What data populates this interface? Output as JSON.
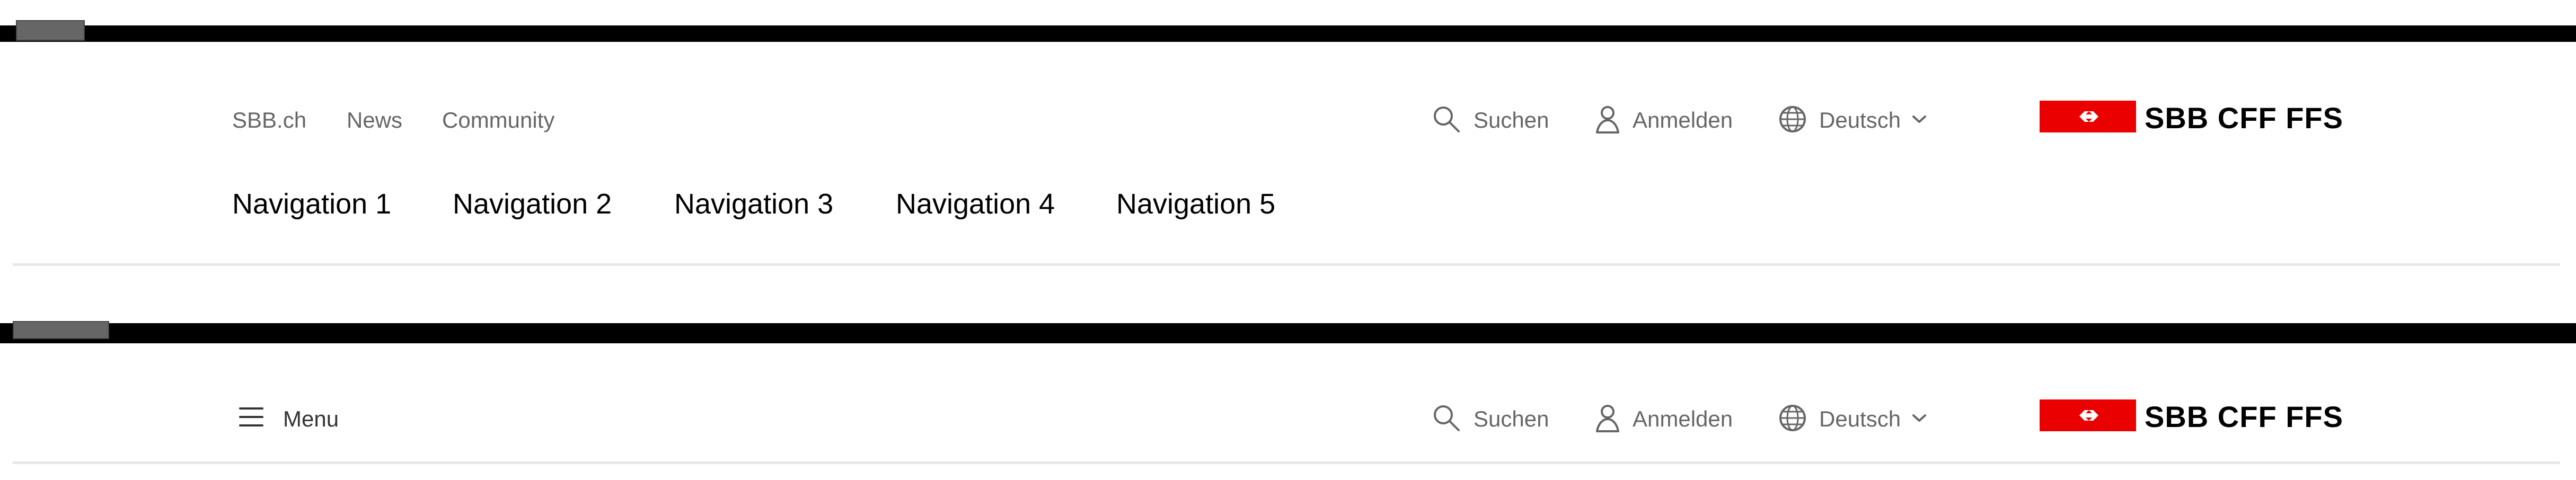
{
  "header": {
    "meta_links": [
      "SBB.ch",
      "News",
      "Community"
    ],
    "search_label": "Suchen",
    "login_label": "Anmelden",
    "language_label": "Deutsch",
    "brand_name": "SBB CFF FFS",
    "menu_label": "Menu"
  },
  "navigation": {
    "items": [
      "Navigation 1",
      "Navigation 2",
      "Navigation 3",
      "Navigation 4",
      "Navigation 5"
    ]
  },
  "icons": {
    "search": "search-icon",
    "login": "user-icon",
    "language": "globe-icon",
    "dropdown": "chevron-down-icon",
    "menu": "menu-icon",
    "logo": "sbb-logo-icon"
  },
  "colors": {
    "brand_red": "#eb0000",
    "separator": "#e7e7e7",
    "muted_text": "#666666"
  }
}
